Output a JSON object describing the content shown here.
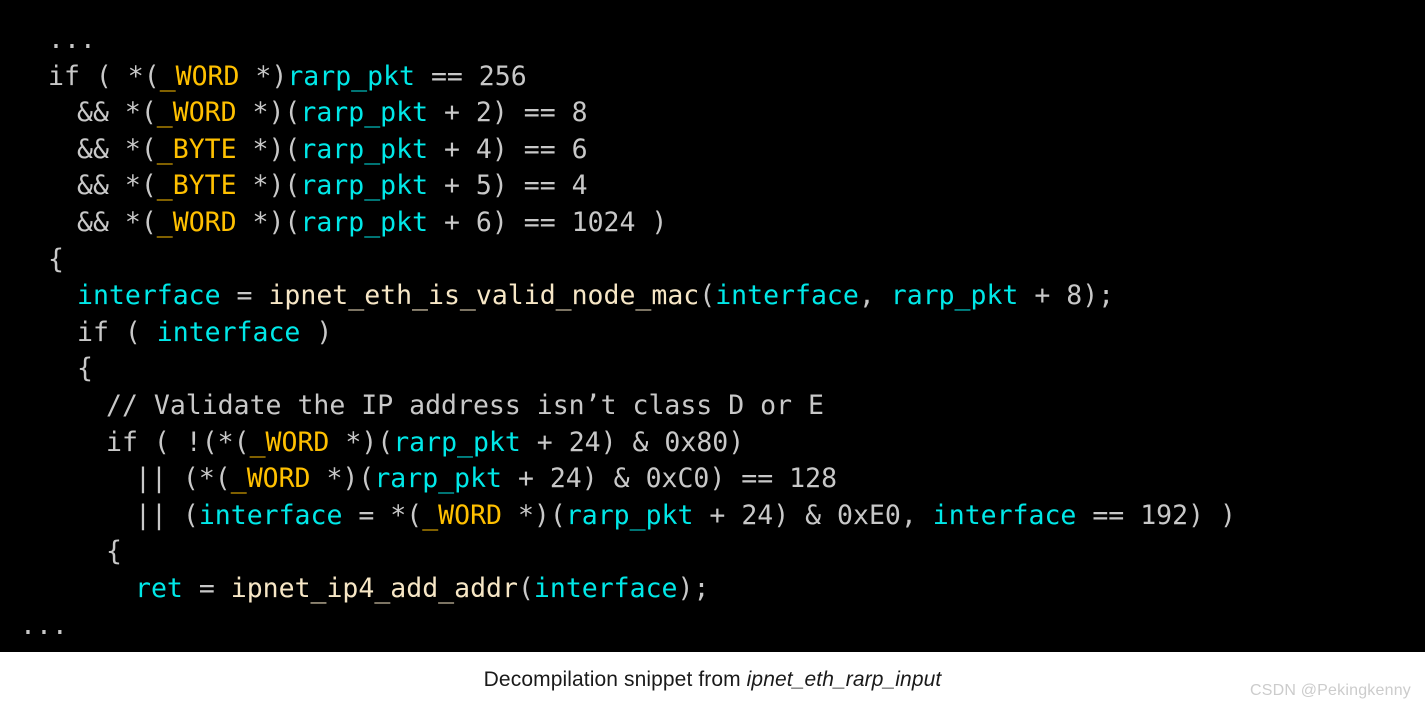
{
  "colors": {
    "background": "#ffffff",
    "code_background": "#000000",
    "plain": "#c8c8c8",
    "type_keyword": "#ffc000",
    "variable": "#00e8e8",
    "function": "#f7e7c6",
    "comment": "#c8c8c8",
    "caption": "#1a1a1a",
    "watermark": "#cccccc"
  },
  "code": {
    "language": "c-decompilation",
    "lines": [
      {
        "indent": 28,
        "tokens": [
          {
            "text": "...",
            "type": "plain"
          }
        ]
      },
      {
        "indent": 28,
        "tokens": [
          {
            "text": "if ( *(",
            "type": "plain"
          },
          {
            "text": "_WORD",
            "type": "type"
          },
          {
            "text": " *)",
            "type": "plain"
          },
          {
            "text": "rarp_pkt",
            "type": "var"
          },
          {
            "text": " == 256",
            "type": "plain"
          }
        ]
      },
      {
        "indent": 57,
        "tokens": [
          {
            "text": "&& *(",
            "type": "plain"
          },
          {
            "text": "_WORD",
            "type": "type"
          },
          {
            "text": " *)(",
            "type": "plain"
          },
          {
            "text": "rarp_pkt",
            "type": "var"
          },
          {
            "text": " + 2) == 8",
            "type": "plain"
          }
        ]
      },
      {
        "indent": 57,
        "tokens": [
          {
            "text": "&& *(",
            "type": "plain"
          },
          {
            "text": "_BYTE",
            "type": "type"
          },
          {
            "text": " *)(",
            "type": "plain"
          },
          {
            "text": "rarp_pkt",
            "type": "var"
          },
          {
            "text": " + 4) == 6",
            "type": "plain"
          }
        ]
      },
      {
        "indent": 57,
        "tokens": [
          {
            "text": "&& *(",
            "type": "plain"
          },
          {
            "text": "_BYTE",
            "type": "type"
          },
          {
            "text": " *)(",
            "type": "plain"
          },
          {
            "text": "rarp_pkt",
            "type": "var"
          },
          {
            "text": " + 5) == 4",
            "type": "plain"
          }
        ]
      },
      {
        "indent": 57,
        "tokens": [
          {
            "text": "&& *(",
            "type": "plain"
          },
          {
            "text": "_WORD",
            "type": "type"
          },
          {
            "text": " *)(",
            "type": "plain"
          },
          {
            "text": "rarp_pkt",
            "type": "var"
          },
          {
            "text": " + 6) == 1024 )",
            "type": "plain"
          }
        ]
      },
      {
        "indent": 28,
        "tokens": [
          {
            "text": "{",
            "type": "plain"
          }
        ]
      },
      {
        "indent": 57,
        "tokens": [
          {
            "text": "interface",
            "type": "var"
          },
          {
            "text": " = ",
            "type": "plain"
          },
          {
            "text": "ipnet_eth_is_valid_node_mac",
            "type": "func"
          },
          {
            "text": "(",
            "type": "plain"
          },
          {
            "text": "interface",
            "type": "var"
          },
          {
            "text": ", ",
            "type": "plain"
          },
          {
            "text": "rarp_pkt",
            "type": "var"
          },
          {
            "text": " + 8);",
            "type": "plain"
          }
        ]
      },
      {
        "indent": 57,
        "tokens": [
          {
            "text": "if ( ",
            "type": "plain"
          },
          {
            "text": "interface",
            "type": "var"
          },
          {
            "text": " )",
            "type": "plain"
          }
        ]
      },
      {
        "indent": 57,
        "tokens": [
          {
            "text": "{",
            "type": "plain"
          }
        ]
      },
      {
        "indent": 86,
        "tokens": [
          {
            "text": "// Validate the IP address isn’t class D or E",
            "type": "comment"
          }
        ]
      },
      {
        "indent": 86,
        "tokens": [
          {
            "text": "if ( !(*(",
            "type": "plain"
          },
          {
            "text": "_WORD",
            "type": "type"
          },
          {
            "text": " *)(",
            "type": "plain"
          },
          {
            "text": "rarp_pkt",
            "type": "var"
          },
          {
            "text": " + 24) & 0x80)",
            "type": "plain"
          }
        ]
      },
      {
        "indent": 115,
        "tokens": [
          {
            "text": "|| (*(",
            "type": "plain"
          },
          {
            "text": "_WORD",
            "type": "type"
          },
          {
            "text": " *)(",
            "type": "plain"
          },
          {
            "text": "rarp_pkt",
            "type": "var"
          },
          {
            "text": " + 24) & 0xC0) == 128",
            "type": "plain"
          }
        ]
      },
      {
        "indent": 115,
        "tokens": [
          {
            "text": "|| (",
            "type": "plain"
          },
          {
            "text": "interface",
            "type": "var"
          },
          {
            "text": " = *(",
            "type": "plain"
          },
          {
            "text": "_WORD",
            "type": "type"
          },
          {
            "text": " *)(",
            "type": "plain"
          },
          {
            "text": "rarp_pkt",
            "type": "var"
          },
          {
            "text": " + 24) & 0xE0, ",
            "type": "plain"
          },
          {
            "text": "interface",
            "type": "var"
          },
          {
            "text": " == 192) )",
            "type": "plain"
          }
        ]
      },
      {
        "indent": 86,
        "tokens": [
          {
            "text": "{",
            "type": "plain"
          }
        ]
      },
      {
        "indent": 115,
        "tokens": [
          {
            "text": "ret",
            "type": "var"
          },
          {
            "text": " = ",
            "type": "plain"
          },
          {
            "text": "ipnet_ip4_add_addr",
            "type": "func"
          },
          {
            "text": "(",
            "type": "plain"
          },
          {
            "text": "interface",
            "type": "var"
          },
          {
            "text": ");",
            "type": "plain"
          }
        ]
      },
      {
        "indent": 0,
        "tokens": [
          {
            "text": "...",
            "type": "plain"
          }
        ]
      }
    ]
  },
  "caption": {
    "prefix": "Decompilation snippet from ",
    "function_name": "ipnet_eth_rarp_input"
  },
  "watermark": {
    "text": "CSDN @Pekingkenny"
  }
}
